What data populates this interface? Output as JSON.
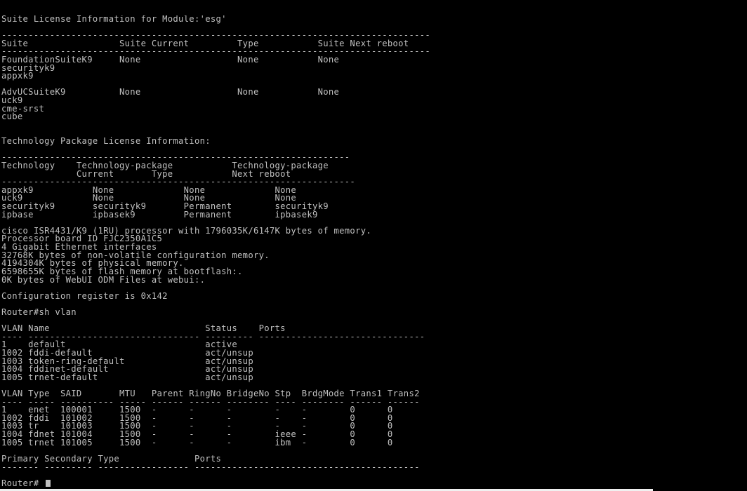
{
  "terminal": {
    "lines": [
      "Suite License Information for Module:'esg'",
      "",
      "--------------------------------------------------------------------------------",
      "Suite                 Suite Current         Type           Suite Next reboot",
      "--------------------------------------------------------------------------------",
      "FoundationSuiteK9     None                  None           None",
      "securityk9",
      "appxk9",
      "",
      "AdvUCSuiteK9          None                  None           None",
      "uck9",
      "cme-srst",
      "cube",
      "",
      "",
      "Technology Package License Information:",
      "",
      "-----------------------------------------------------------------",
      "Technology    Technology-package           Technology-package",
      "              Current       Type           Next reboot",
      "------------------------------------------------------------------",
      "appxk9           None             None             None",
      "uck9             None             None             None",
      "securityk9       securityk9       Permanent        securityk9",
      "ipbase           ipbasek9         Permanent        ipbasek9",
      "",
      "cisco ISR4431/K9 (1RU) processor with 1796035K/6147K bytes of memory.",
      "Processor board ID FJC2350A1C5",
      "4 Gigabit Ethernet interfaces",
      "32768K bytes of non-volatile configuration memory.",
      "4194304K bytes of physical memory.",
      "6598655K bytes of flash memory at bootflash:.",
      "0K bytes of WebUI ODM Files at webui:.",
      "",
      "Configuration register is 0x142",
      "",
      "Router#sh vlan",
      "",
      "VLAN Name                             Status    Ports",
      "---- -------------------------------- --------- -------------------------------",
      "1    default                          active",
      "1002 fddi-default                     act/unsup",
      "1003 token-ring-default               act/unsup",
      "1004 fddinet-default                  act/unsup",
      "1005 trnet-default                    act/unsup",
      "",
      "VLAN Type  SAID       MTU   Parent RingNo BridgeNo Stp  BrdgMode Trans1 Trans2",
      "---- ----- ---------- ----- ------ ------ -------- ---- -------- ------ ------",
      "1    enet  100001     1500  -      -      -        -    -        0      0",
      "1002 fddi  101002     1500  -      -      -        -    -        0      0",
      "1003 tr    101003     1500  -      -      -        -    -        0      0",
      "1004 fdnet 101004     1500  -      -      -        ieee -        0      0",
      "1005 trnet 101005     1500  -      -      -        ibm  -        0      0",
      "",
      "Primary Secondary Type              Ports",
      "------- --------- ----------------- ------------------------------------------",
      "",
      "Router# "
    ]
  },
  "colors": {
    "background": "#000000",
    "foreground": "#c0c0c0",
    "scrollbar": "#f0f0f0"
  }
}
